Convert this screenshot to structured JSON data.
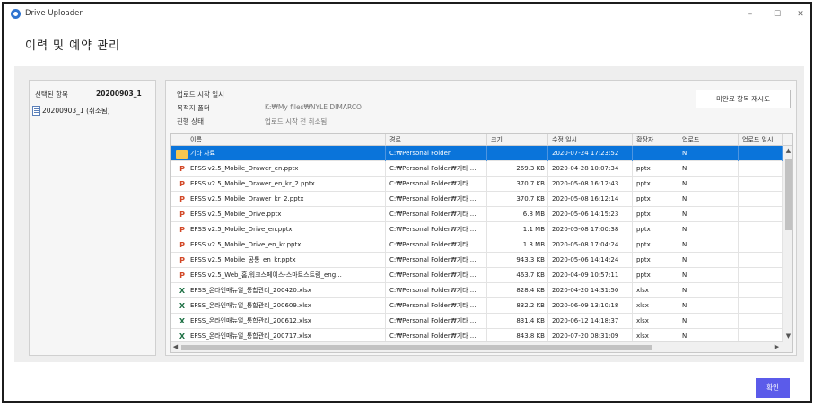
{
  "window": {
    "title": "Drive Uploader",
    "minimize": "–",
    "maximize": "☐",
    "close": "✕"
  },
  "header": {
    "title": "이력 및 예약 관리"
  },
  "left_panel": {
    "selected_label": "선택된 항목",
    "selected_value": "20200903_1",
    "tree_item": "20200903_1 (취소됨)"
  },
  "info": {
    "start_label": "업로드 시작 일시",
    "start_value": "",
    "dest_label": "목적지 폴더",
    "dest_value": "K:₩My files₩NYLE DIMARCO",
    "status_label": "진행 상태",
    "status_value": "업로드 시작 전 취소됨"
  },
  "retry_button": "미완료 항목 재시도",
  "confirm_button": "확인",
  "table": {
    "columns": [
      "이름",
      "경로",
      "크기",
      "수정 일시",
      "확장자",
      "업로드",
      "업로드 일시"
    ],
    "rows": [
      {
        "type": "folder",
        "name": "기타 자료",
        "path": "C:₩Personal Folder",
        "size": "",
        "modified": "2020-07-24 17:23:52",
        "ext": "",
        "uploaded": "N",
        "upload_time": ""
      },
      {
        "type": "pptx",
        "name": "EFSS v2.5_Mobile_Drawer_en.pptx",
        "path": "C:₩Personal Folder₩기타 ...",
        "size": "269.3 KB",
        "modified": "2020-04-28 10:07:34",
        "ext": "pptx",
        "uploaded": "N",
        "upload_time": ""
      },
      {
        "type": "pptx",
        "name": "EFSS v2.5_Mobile_Drawer_en_kr_2.pptx",
        "path": "C:₩Personal Folder₩기타 ...",
        "size": "370.7 KB",
        "modified": "2020-05-08 16:12:43",
        "ext": "pptx",
        "uploaded": "N",
        "upload_time": ""
      },
      {
        "type": "pptx",
        "name": "EFSS v2.5_Mobile_Drawer_kr_2.pptx",
        "path": "C:₩Personal Folder₩기타 ...",
        "size": "370.7 KB",
        "modified": "2020-05-08 16:12:14",
        "ext": "pptx",
        "uploaded": "N",
        "upload_time": ""
      },
      {
        "type": "pptx",
        "name": "EFSS v2.5_Mobile_Drive.pptx",
        "path": "C:₩Personal Folder₩기타 ...",
        "size": "6.8 MB",
        "modified": "2020-05-06 14:15:23",
        "ext": "pptx",
        "uploaded": "N",
        "upload_time": ""
      },
      {
        "type": "pptx",
        "name": "EFSS v2.5_Mobile_Drive_en.pptx",
        "path": "C:₩Personal Folder₩기타 ...",
        "size": "1.1 MB",
        "modified": "2020-05-08 17:00:38",
        "ext": "pptx",
        "uploaded": "N",
        "upload_time": ""
      },
      {
        "type": "pptx",
        "name": "EFSS v2.5_Mobile_Drive_en_kr.pptx",
        "path": "C:₩Personal Folder₩기타 ...",
        "size": "1.3 MB",
        "modified": "2020-05-08 17:04:24",
        "ext": "pptx",
        "uploaded": "N",
        "upload_time": ""
      },
      {
        "type": "pptx",
        "name": "EFSS v2.5_Mobile_공통_en_kr.pptx",
        "path": "C:₩Personal Folder₩기타 ...",
        "size": "943.3 KB",
        "modified": "2020-05-06 14:14:24",
        "ext": "pptx",
        "uploaded": "N",
        "upload_time": ""
      },
      {
        "type": "pptx",
        "name": "EFSS v2.5_Web_홈,워크스페이스-스마트스트림_eng...",
        "path": "C:₩Personal Folder₩기타 ...",
        "size": "463.7 KB",
        "modified": "2020-04-09 10:57:11",
        "ext": "pptx",
        "uploaded": "N",
        "upload_time": ""
      },
      {
        "type": "xlsx",
        "name": "EFSS_온라인매뉴얼_통합관리_200420.xlsx",
        "path": "C:₩Personal Folder₩기타 ...",
        "size": "828.4 KB",
        "modified": "2020-04-20 14:31:50",
        "ext": "xlsx",
        "uploaded": "N",
        "upload_time": ""
      },
      {
        "type": "xlsx",
        "name": "EFSS_온라인매뉴얼_통합관리_200609.xlsx",
        "path": "C:₩Personal Folder₩기타 ...",
        "size": "832.2 KB",
        "modified": "2020-06-09 13:10:18",
        "ext": "xlsx",
        "uploaded": "N",
        "upload_time": ""
      },
      {
        "type": "xlsx",
        "name": "EFSS_온라인매뉴얼_통합관리_200612.xlsx",
        "path": "C:₩Personal Folder₩기타 ...",
        "size": "831.4 KB",
        "modified": "2020-06-12 14:18:37",
        "ext": "xlsx",
        "uploaded": "N",
        "upload_time": ""
      },
      {
        "type": "xlsx",
        "name": "EFSS_온라인매뉴얼_통합관리_200717.xlsx",
        "path": "C:₩Personal Folder₩기타 ...",
        "size": "843.8 KB",
        "modified": "2020-07-20 08:31:09",
        "ext": "xlsx",
        "uploaded": "N",
        "upload_time": ""
      }
    ]
  },
  "icons": {
    "app": "drive-uploader-icon",
    "pptx": "P",
    "xlsx": "X",
    "folder": "folder-icon"
  },
  "colors": {
    "selection": "#0a74da",
    "confirm_button": "#5b5bea",
    "pptx_icon": "#d24726",
    "xlsx_icon": "#1e7145",
    "folder_icon": "#f5c750"
  }
}
